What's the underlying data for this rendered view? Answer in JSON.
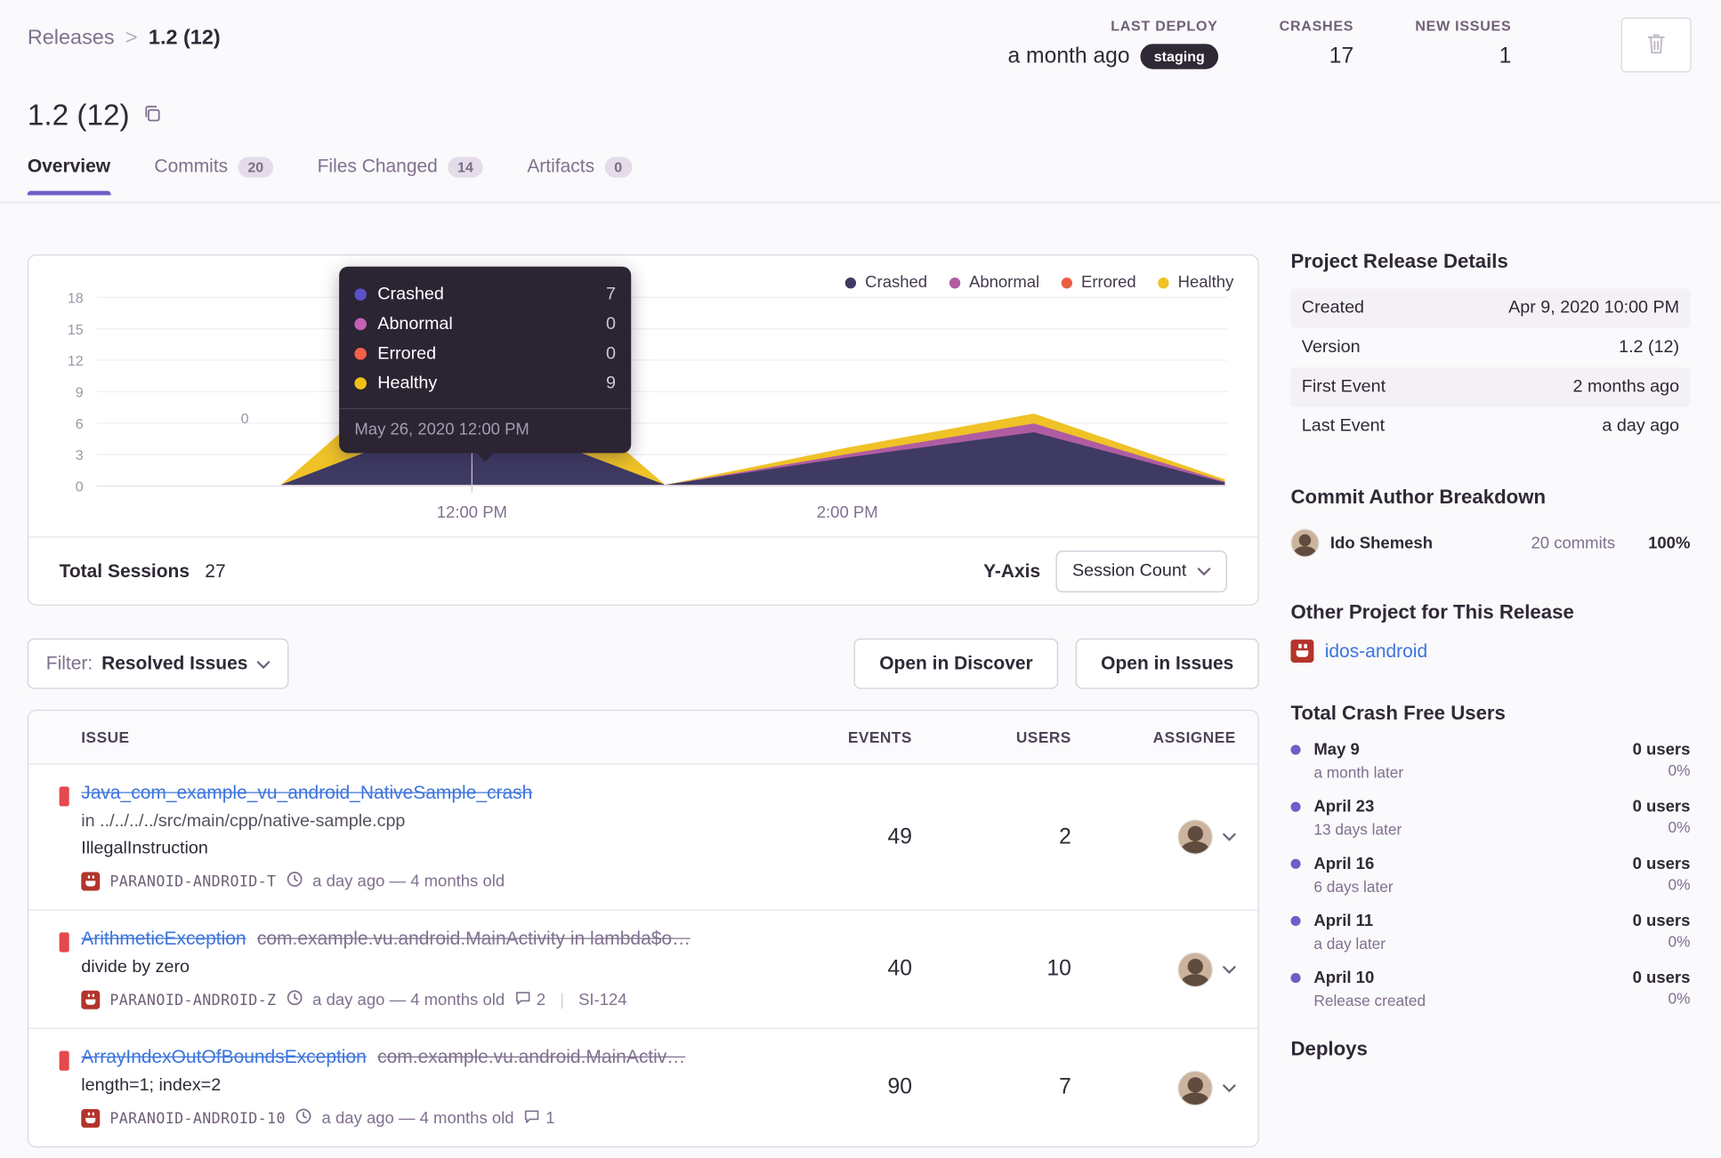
{
  "accent_color": "#6c5fc7",
  "breadcrumb": {
    "parent": "Releases",
    "separator": ">",
    "current": "1.2 (12)"
  },
  "stats": {
    "last_deploy": {
      "label": "LAST DEPLOY",
      "value": "a month ago",
      "badge": "staging"
    },
    "crashes": {
      "label": "CRASHES",
      "value": "17"
    },
    "new_issues": {
      "label": "NEW ISSUES",
      "value": "1"
    }
  },
  "title": {
    "text": "1.2 (12)"
  },
  "tabs": [
    {
      "label": "Overview"
    },
    {
      "label": "Commits",
      "count": "20"
    },
    {
      "label": "Files Changed",
      "count": "14"
    },
    {
      "label": "Artifacts",
      "count": "0"
    }
  ],
  "chart": {
    "legend": [
      {
        "label": "Crashed",
        "color": "#3e3a63"
      },
      {
        "label": "Abnormal",
        "color": "#b05ca3"
      },
      {
        "label": "Errored",
        "color": "#ec5e44"
      },
      {
        "label": "Healthy",
        "color": "#efc227"
      }
    ],
    "yticks": [
      "18",
      "15",
      "12",
      "9",
      "6",
      "3",
      "0"
    ],
    "xticks": [
      "12:00 PM",
      "2:00 PM"
    ],
    "zero_label": "0",
    "tooltip": {
      "rows": [
        {
          "label": "Crashed",
          "value": "7"
        },
        {
          "label": "Abnormal",
          "value": "0"
        },
        {
          "label": "Errored",
          "value": "0"
        },
        {
          "label": "Healthy",
          "value": "9"
        }
      ],
      "footer": "May 26, 2020 12:00 PM"
    },
    "footer": {
      "total_label": "Total Sessions",
      "total_value": "27",
      "yaxis_label": "Y-Axis",
      "yaxis_value": "Session Count"
    }
  },
  "chart_data": {
    "type": "area",
    "stacked": true,
    "title": "Release sessions over time",
    "x": [
      "10:00 AM",
      "11:00 AM",
      "12:00 PM",
      "1:00 PM",
      "2:00 PM",
      "3:00 PM",
      "4:00 PM"
    ],
    "series": [
      {
        "name": "Crashed",
        "values": [
          0,
          0,
          7,
          0,
          3,
          5,
          0
        ]
      },
      {
        "name": "Abnormal",
        "values": [
          0,
          0,
          0,
          0,
          0,
          1,
          0
        ]
      },
      {
        "name": "Errored",
        "values": [
          0,
          0,
          0,
          0,
          0,
          0,
          0
        ]
      },
      {
        "name": "Healthy",
        "values": [
          0,
          0,
          9,
          0,
          1,
          1,
          0
        ]
      }
    ],
    "ylim": [
      0,
      18
    ],
    "x_tick_labels": [
      "12:00 PM",
      "2:00 PM"
    ],
    "legend_position": "top-right",
    "grid": true,
    "total_sessions": 27,
    "tooltip_point": {
      "time": "May 26, 2020 12:00 PM",
      "Crashed": 7,
      "Abnormal": 0,
      "Errored": 0,
      "Healthy": 9
    }
  },
  "filter": {
    "prefix": "Filter:",
    "value": "Resolved Issues"
  },
  "actions": {
    "open_discover": "Open in Discover",
    "open_issues": "Open in Issues"
  },
  "issues": {
    "columns": [
      "ISSUE",
      "EVENTS",
      "USERS",
      "ASSIGNEE"
    ],
    "rows": [
      {
        "title": "Java_com_example_vu_android_NativeSample_crash",
        "location": "in ../../../../src/main/cpp/native-sample.cpp",
        "message": "IllegalInstruction",
        "project": "PARANOID-ANDROID-T",
        "age": "a day ago — 4 months old",
        "events": "49",
        "users": "2"
      },
      {
        "title": "ArithmeticException",
        "subtitle": "com.example.vu.android.MainActivity in lambda$o…",
        "message": "divide by zero",
        "project": "PARANOID-ANDROID-Z",
        "age": "a day ago — 4 months old",
        "comments": "2",
        "ref": "SI-124",
        "events": "40",
        "users": "10"
      },
      {
        "title": "ArrayIndexOutOfBoundsException",
        "subtitle": "com.example.vu.android.MainActiv…",
        "message": "length=1; index=2",
        "project": "PARANOID-ANDROID-10",
        "age": "a day ago — 4 months old",
        "comments": "1",
        "events": "90",
        "users": "7"
      }
    ]
  },
  "sidebar": {
    "details": {
      "title": "Project Release Details",
      "rows": [
        {
          "label": "Created",
          "value": "Apr 9, 2020 10:00 PM"
        },
        {
          "label": "Version",
          "value": "1.2 (12)"
        },
        {
          "label": "First Event",
          "value": "2 months ago"
        },
        {
          "label": "Last Event",
          "value": "a day ago"
        }
      ]
    },
    "authors": {
      "title": "Commit Author Breakdown",
      "name": "Ido Shemesh",
      "commits": "20 commits",
      "percent": "100%"
    },
    "other": {
      "title": "Other Project for This Release",
      "link": "idos-android"
    },
    "crash_free": {
      "title": "Total Crash Free Users",
      "items": [
        {
          "date": "May 9",
          "users": "0 users",
          "sub": "a month later",
          "percent": "0%"
        },
        {
          "date": "April 23",
          "users": "0 users",
          "sub": "13 days later",
          "percent": "0%"
        },
        {
          "date": "April 16",
          "users": "0 users",
          "sub": "6 days later",
          "percent": "0%"
        },
        {
          "date": "April 11",
          "users": "0 users",
          "sub": "a day later",
          "percent": "0%"
        },
        {
          "date": "April 10",
          "users": "0 users",
          "sub": "Release created",
          "percent": "0%"
        }
      ]
    },
    "deploys": {
      "title": "Deploys"
    }
  }
}
